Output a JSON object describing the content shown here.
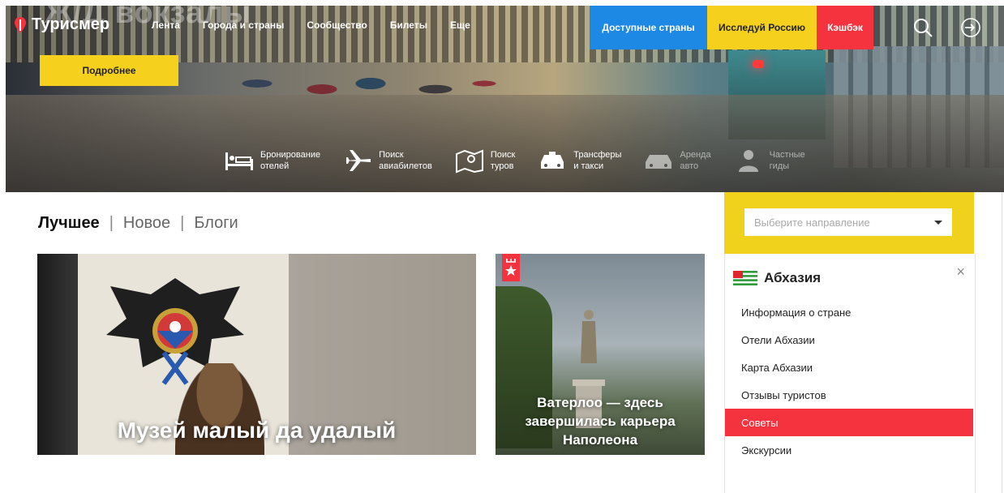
{
  "hero": {
    "ghost_title": "Ж/Д вокзалы"
  },
  "nav": {
    "logo": "Турисмер",
    "links": [
      "Лента",
      "Города и страны",
      "Сообщество",
      "Билеты",
      "Еще"
    ],
    "btn_countries": "Доступные страны",
    "btn_russia": "Исследуй Россию",
    "btn_cashback": "Кэшбэк"
  },
  "more_button": "Подробнее",
  "services": [
    {
      "icon": "bed-icon",
      "label": "Бронирование\nотелей"
    },
    {
      "icon": "airplane-icon",
      "label": "Поиск\nавиабилетов"
    },
    {
      "icon": "map-icon",
      "label": "Поиск\nтуров"
    },
    {
      "icon": "taxi-icon",
      "label": "Трансферы\nи такси"
    },
    {
      "icon": "car-icon",
      "label": "Аренда\nавто"
    },
    {
      "icon": "guide-icon",
      "label": "Частные\nгиды"
    }
  ],
  "tabs": {
    "best": "Лучшее",
    "new": "Новое",
    "blogs": "Блоги",
    "sep": "|"
  },
  "cards": [
    {
      "title": "Музей малый да удалый"
    },
    {
      "title": "Ватерлоо — здесь завершилась карьера Наполеона"
    }
  ],
  "sidebar": {
    "select_placeholder": "Выберите направление",
    "country": "Абхазия",
    "close": "×",
    "items": [
      "Информация о стране",
      "Отели Абхазии",
      "Карта Абхазии",
      "Отзывы туристов",
      "Советы",
      "Экскурсии"
    ],
    "active_index": 4
  },
  "colors": {
    "blue": "#1e88e5",
    "yellow": "#f5d11d",
    "red": "#f5333f"
  }
}
